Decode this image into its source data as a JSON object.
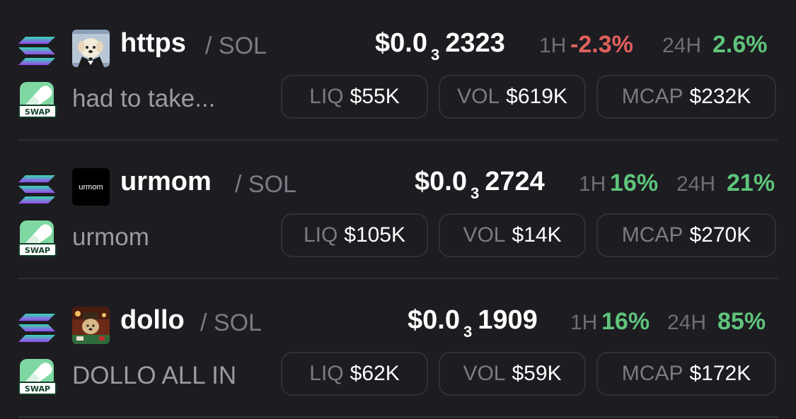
{
  "colors": {
    "background": "#1c1c21",
    "positive": "#5fc47b",
    "negative": "#e0605c",
    "muted": "#7b7b85"
  },
  "icons": {
    "chain": "solana-icon",
    "swap": "swap-pill-icon",
    "swap_text": "SWAP"
  },
  "rows": [
    {
      "name": "https",
      "pair": "/ SOL",
      "description": "had to take...",
      "price_prefix": "$0.0",
      "price_sub": "3",
      "price_digits": "2323",
      "h1_label": "1H",
      "h1_change": "-2.3%",
      "h1_direction": "negative",
      "h24_label": "24H",
      "h24_change": "2.6%",
      "h24_direction": "positive",
      "liq_label": "LIQ",
      "liq": "$55K",
      "vol_label": "VOL",
      "vol": "$619K",
      "mcap_label": "MCAP",
      "mcap": "$232K",
      "avatar": "dog-in-tuxedo-avatar"
    },
    {
      "name": "urmom",
      "pair": "/ SOL",
      "description": "urmom",
      "price_prefix": "$0.0",
      "price_sub": "3",
      "price_digits": "2724",
      "h1_label": "1H",
      "h1_change": "16%",
      "h1_direction": "positive",
      "h24_label": "24H",
      "h24_change": "21%",
      "h24_direction": "positive",
      "liq_label": "LIQ",
      "liq": "$105K",
      "vol_label": "VOL",
      "vol": "$14K",
      "mcap_label": "MCAP",
      "mcap": "$270K",
      "avatar": "urmom-logo-avatar",
      "avatar_text": "urmom"
    },
    {
      "name": "dollo",
      "pair": "/ SOL",
      "description": "DOLLO ALL IN",
      "price_prefix": "$0.0",
      "price_sub": "3",
      "price_digits": "1909",
      "h1_label": "1H",
      "h1_change": "16%",
      "h1_direction": "positive",
      "h24_label": "24H",
      "h24_change": "85%",
      "h24_direction": "positive",
      "liq_label": "LIQ",
      "liq": "$62K",
      "vol_label": "VOL",
      "vol": "$59K",
      "mcap_label": "MCAP",
      "mcap": "$172K",
      "avatar": "dog-at-poker-table-avatar"
    }
  ]
}
